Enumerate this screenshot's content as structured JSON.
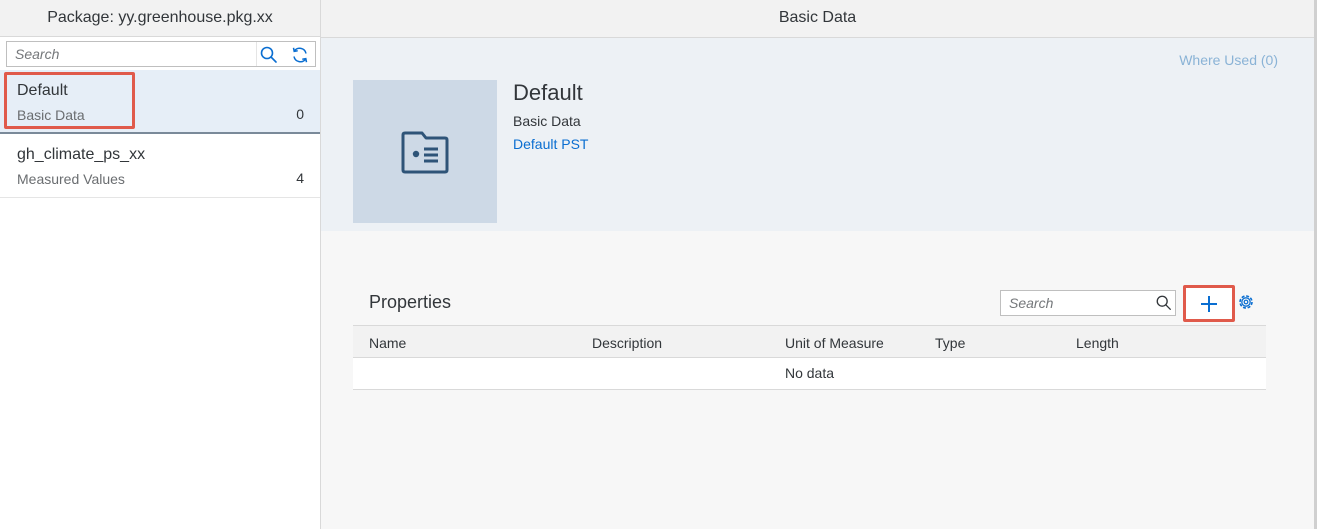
{
  "master": {
    "title": "Package: yy.greenhouse.pkg.xx",
    "search_placeholder": "Search",
    "items": [
      {
        "title": "Default",
        "subtitle": "Basic Data",
        "count": "0"
      },
      {
        "title": "gh_climate_ps_xx",
        "subtitle": "Measured Values",
        "count": "4"
      }
    ]
  },
  "detail": {
    "title": "Basic Data",
    "where_used": "Where Used (0)",
    "object": {
      "title": "Default",
      "subtitle": "Basic Data",
      "link": "Default PST",
      "icon": "id-card-icon"
    },
    "properties": {
      "title": "Properties",
      "search_placeholder": "Search",
      "columns": [
        "Name",
        "Description",
        "Unit of Measure",
        "Type",
        "Length"
      ],
      "empty_text": "No data"
    }
  },
  "colors": {
    "accent": "#0a6ed1",
    "highlight": "#e05a4b",
    "selected_bg": "#e6eef7",
    "header_bg": "#edf1f5"
  }
}
